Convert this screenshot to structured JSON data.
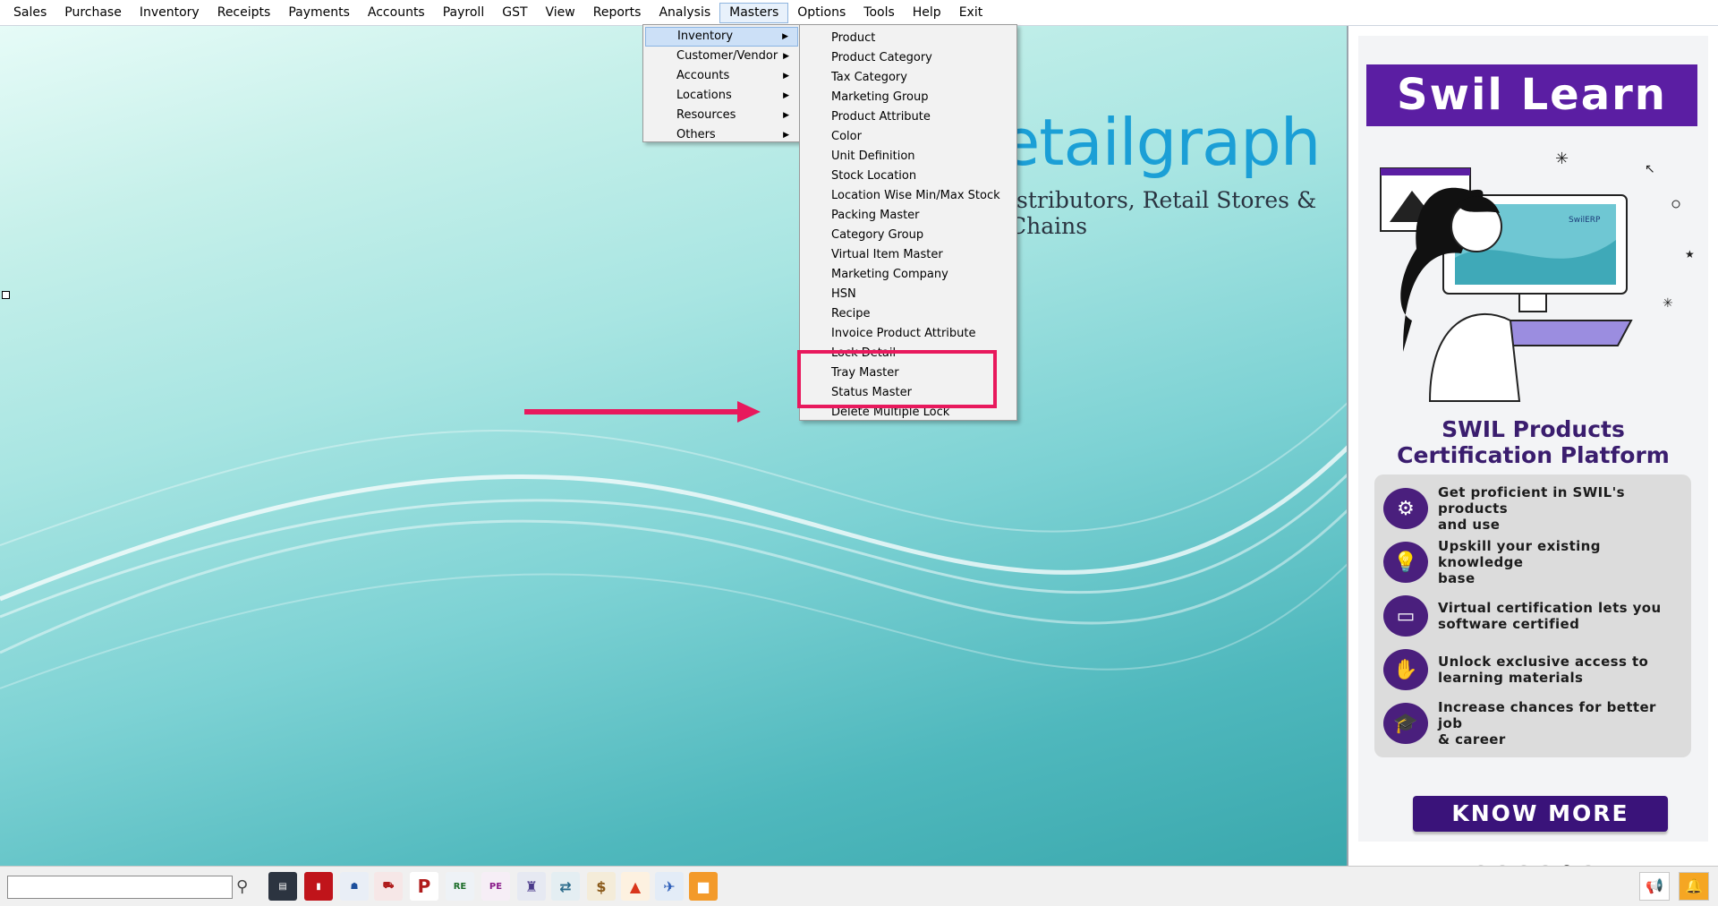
{
  "menubar": {
    "items": [
      "Sales",
      "Purchase",
      "Inventory",
      "Receipts",
      "Payments",
      "Accounts",
      "Payroll",
      "GST",
      "View",
      "Reports",
      "Analysis",
      "Masters",
      "Options",
      "Tools",
      "Help",
      "Exit"
    ],
    "active": "Masters"
  },
  "masters_menu": {
    "items": [
      "Inventory",
      "Customer/Vendor",
      "Accounts",
      "Locations",
      "Resources",
      "Others"
    ],
    "selected": "Inventory"
  },
  "inventory_submenu": {
    "items": [
      "Product",
      "Product Category",
      "Tax Category",
      "Marketing Group",
      "Product Attribute",
      "Color",
      "Unit Definition",
      "Stock Location",
      "Location Wise Min/Max Stock",
      "Packing Master",
      "Category Group",
      "Virtual Item Master",
      "Marketing Company",
      "HSN",
      "Recipe",
      "Invoice Product Attribute",
      "Lock Detail",
      "Tray Master",
      "Status Master",
      "Delete Multiple Lock"
    ],
    "highlighted": [
      "Tray Master",
      "Status Master"
    ]
  },
  "workspace": {
    "logo_text": "etailgraph",
    "logo_subtitle": "istributors, Retail Stores & Chains"
  },
  "ad": {
    "title": "Swil Learn",
    "headline_line1": "SWIL Products",
    "headline_line2": "Certification Platform",
    "benefits": [
      {
        "line1": "Get proficient in SWIL's products",
        "line2": "and use",
        "icon": "gear-people-icon"
      },
      {
        "line1": "Upskill your existing knowledge",
        "line2": "base",
        "icon": "book-bulb-icon"
      },
      {
        "line1": "Virtual certification lets you",
        "line2": "software certified",
        "icon": "certificate-icon"
      },
      {
        "line1": "Unlock exclusive access to",
        "line2": "learning materials",
        "icon": "unlock-icon"
      },
      {
        "line1": "Increase chances for better job",
        "line2": "& career",
        "icon": "career-icon"
      }
    ],
    "button": "KNOW MORE",
    "carousel_count": 6,
    "carousel_active": 5,
    "screen_badge": "SwilERP"
  },
  "toolbar": {
    "search_value": "",
    "icons": [
      "register-icon",
      "pdf-red-icon",
      "person-doc-icon",
      "truck-icon",
      "pos-icon",
      "re-doc-icon",
      "pe-doc-icon",
      "stamp-icon",
      "flow-icon",
      "money-bag-icon",
      "shapes-icon",
      "scanner-icon",
      "box-icon"
    ],
    "labels": {
      "re": "RE",
      "pe": "PE"
    }
  },
  "colors": {
    "accent": "#5b1ea3",
    "highlight": "#e8195d",
    "logo": "#1b9fd6"
  }
}
